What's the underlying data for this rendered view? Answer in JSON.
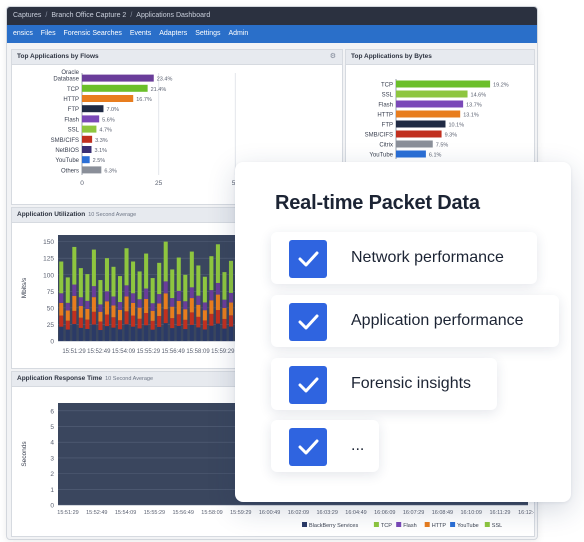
{
  "breadcrumb": {
    "items": [
      "Captures",
      "Branch Office Capture 2",
      "Applications Dashboard"
    ]
  },
  "nav": {
    "items": [
      "ensics",
      "Files",
      "Forensic Searches",
      "Events",
      "Adapters",
      "Settings",
      "Admin"
    ]
  },
  "panels": {
    "flows": {
      "title": "Top Applications by Flows"
    },
    "bytes": {
      "title": "Top Applications by Bytes"
    },
    "utilization": {
      "title": "Application Utilization",
      "subtitle": "10 Second Average"
    },
    "response": {
      "title": "Application Response Time",
      "subtitle": "10 Second Average"
    }
  },
  "icons": {
    "settings": "gear-icon",
    "check": "checkmark-icon"
  },
  "colors": {
    "accent": "#2f64e0",
    "nav": "#2a6fc9",
    "header": "#2b3140",
    "plot_bg": "#3a465e"
  },
  "chart_data": [
    {
      "type": "bar",
      "orientation": "horizontal",
      "title": "Top Applications by Flows",
      "categories": [
        "Oracle Database",
        "TCP",
        "HTTP",
        "FTP",
        "Flash",
        "SSL",
        "SMB/CIFS",
        "NetBIOS",
        "YouTube",
        "Others"
      ],
      "category_lines": [
        [
          "Oracle",
          "Database"
        ],
        [
          "TCP"
        ],
        [
          "HTTP"
        ],
        [
          "FTP"
        ],
        [
          "Flash"
        ],
        [
          "SSL"
        ],
        [
          "SMB/CIFS"
        ],
        [
          "NetBIOS"
        ],
        [
          "YouTube"
        ],
        [
          "Others"
        ]
      ],
      "values": [
        23.4,
        21.4,
        16.7,
        7.0,
        5.6,
        4.7,
        3.3,
        3.1,
        2.5,
        6.3
      ],
      "labels": [
        "23.4%",
        "21.4%",
        "16.7%",
        "7.0%",
        "5.6%",
        "4.7%",
        "3.3%",
        "3.1%",
        "2.5%",
        "6.3%"
      ],
      "colors": [
        "#6a3d9a",
        "#6bbf2a",
        "#e87d1e",
        "#1f2a44",
        "#7a48b8",
        "#8ec63f",
        "#c1301f",
        "#3a2f74",
        "#2b6fd6",
        "#8a8f99"
      ],
      "xticks": [
        "0",
        "25",
        "50"
      ],
      "xlim": [
        0,
        75
      ]
    },
    {
      "type": "bar",
      "orientation": "horizontal",
      "title": "Top Applications by Bytes",
      "categories": [
        "TCP",
        "SSL",
        "Flash",
        "HTTP",
        "FTP",
        "SMB/CIFS",
        "Citrix",
        "YouTube"
      ],
      "values": [
        19.2,
        14.6,
        13.7,
        13.1,
        10.1,
        9.3,
        7.5,
        6.1
      ],
      "labels": [
        "19.2%",
        "14.6%",
        "13.7%",
        "13.1%",
        "10.1%",
        "9.3%",
        "7.5%",
        "6.1%"
      ],
      "colors": [
        "#6bbf2a",
        "#8ec63f",
        "#7a48b8",
        "#e87d1e",
        "#1f2a44",
        "#c1301f",
        "#8a8f99",
        "#2b6fd6"
      ],
      "xlim": [
        0,
        20
      ]
    },
    {
      "type": "bar",
      "stacked": true,
      "title": "Application Utilization",
      "subtitle": "10 Second Average",
      "ylabel": "Mbits/s",
      "yticks": [
        0,
        25,
        50,
        75,
        100,
        125,
        150
      ],
      "ylim": [
        0,
        160
      ],
      "xticks": [
        "15:51:29",
        "15:52:49",
        "15:54:09",
        "15:55:29",
        "15:56:49",
        "15:58:09",
        "15:59:29"
      ],
      "series_colors": [
        "#2b3a66",
        "#c1301f",
        "#e87d1e",
        "#6a3d9a",
        "#8ec63f"
      ],
      "series_fractions": [
        0.18,
        0.14,
        0.16,
        0.12,
        0.4
      ],
      "totals": [
        120,
        96,
        142,
        110,
        101,
        138,
        92,
        125,
        112,
        98,
        140,
        120,
        105,
        132,
        95,
        118,
        150,
        108,
        126,
        100,
        135,
        114,
        97,
        128,
        146,
        104,
        121,
        99,
        133,
        115,
        107,
        141,
        123,
        96,
        130,
        110,
        138,
        102,
        118,
        127,
        100,
        144,
        112,
        99,
        129,
        121,
        105,
        137,
        94,
        124,
        113,
        140,
        101,
        119,
        126,
        98,
        134,
        116,
        108,
        143,
        122,
        97,
        131,
        111,
        139,
        103,
        117,
        128,
        100,
        145,
        114,
        95
      ]
    },
    {
      "type": "area",
      "title": "Application Response Time",
      "subtitle": "10 Second Average",
      "ylabel": "Seconds",
      "yticks": [
        0,
        1,
        2,
        3,
        4,
        5,
        6
      ],
      "ylim": [
        0,
        6.5
      ],
      "xticks": [
        "15:51:29",
        "15:52:49",
        "15:54:09",
        "15:55:29",
        "15:56:49",
        "15:58:09",
        "15:59:29",
        "16:00:49",
        "16:02:09",
        "16:03:29",
        "16:04:49",
        "16:06:09",
        "16:07:29",
        "16:08:49",
        "16:10:09",
        "16:11:29",
        "16:12:49"
      ],
      "legend": [
        "BlackBerry Services",
        "TCP",
        "Flash",
        "HTTP",
        "YouTube",
        "SSL"
      ],
      "legend_colors": [
        "#2b3a66",
        "#8ec63f",
        "#7a48b8",
        "#e87d1e",
        "#2b6fd6",
        "#8ec63f",
        "#c1301f"
      ]
    }
  ],
  "card": {
    "title": "Real-time Packet Data",
    "items": [
      {
        "label": "Network performance"
      },
      {
        "label": "Application performance"
      },
      {
        "label": "Forensic insights"
      },
      {
        "label": "..."
      }
    ]
  }
}
